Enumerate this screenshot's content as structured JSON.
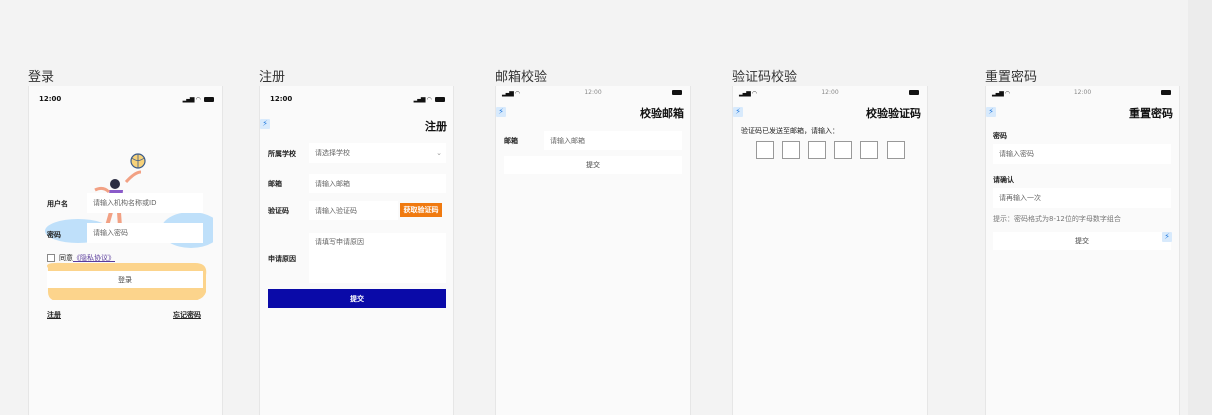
{
  "time": "12:00",
  "boards": {
    "login": "登录",
    "register": "注册",
    "email_verify": "邮箱校验",
    "code_verify": "验证码校验",
    "reset_password": "重置密码"
  },
  "login": {
    "username_label": "用户名",
    "username_placeholder": "请输入机构名称或ID",
    "password_label": "密码",
    "password_placeholder": "请输入密码",
    "agree_text": "同意",
    "privacy_link": "《隐私协议》",
    "login_button": "登录",
    "register_link": "注册",
    "forgot_link": "忘记密码"
  },
  "register": {
    "title": "注册",
    "school_label": "所属学校",
    "school_placeholder": "请选择学校",
    "email_label": "邮箱",
    "email_placeholder": "请输入邮箱",
    "code_label": "验证码",
    "code_placeholder": "请输入验证码",
    "get_code_button": "获取验证码",
    "reason_label": "申请原因",
    "reason_placeholder": "请填写申请原因",
    "submit_button": "提交"
  },
  "email_verify": {
    "title": "校验邮箱",
    "email_label": "邮箱",
    "email_placeholder": "请输入邮箱",
    "submit_button": "提交"
  },
  "code_verify": {
    "title": "校验验证码",
    "prompt": "验证码已发送至邮箱，请输入："
  },
  "reset": {
    "title": "重置密码",
    "password_label": "密码",
    "password_placeholder": "请输入密码",
    "confirm_label": "请确认",
    "confirm_placeholder": "请再输入一次",
    "hint": "提示：密码格式为8-12位的字母数字组合",
    "submit_button": "提交"
  },
  "colors": {
    "primary_blue": "#0a0aa8",
    "orange": "#f07a10",
    "link_purple": "#5a3c9c",
    "icon_blue": "#2b7fe0"
  },
  "icons": [
    "signal-icon",
    "wifi-icon",
    "battery-icon",
    "bolt-icon",
    "chevron-down-icon",
    "checkbox-icon",
    "volleyball-illustration"
  ]
}
